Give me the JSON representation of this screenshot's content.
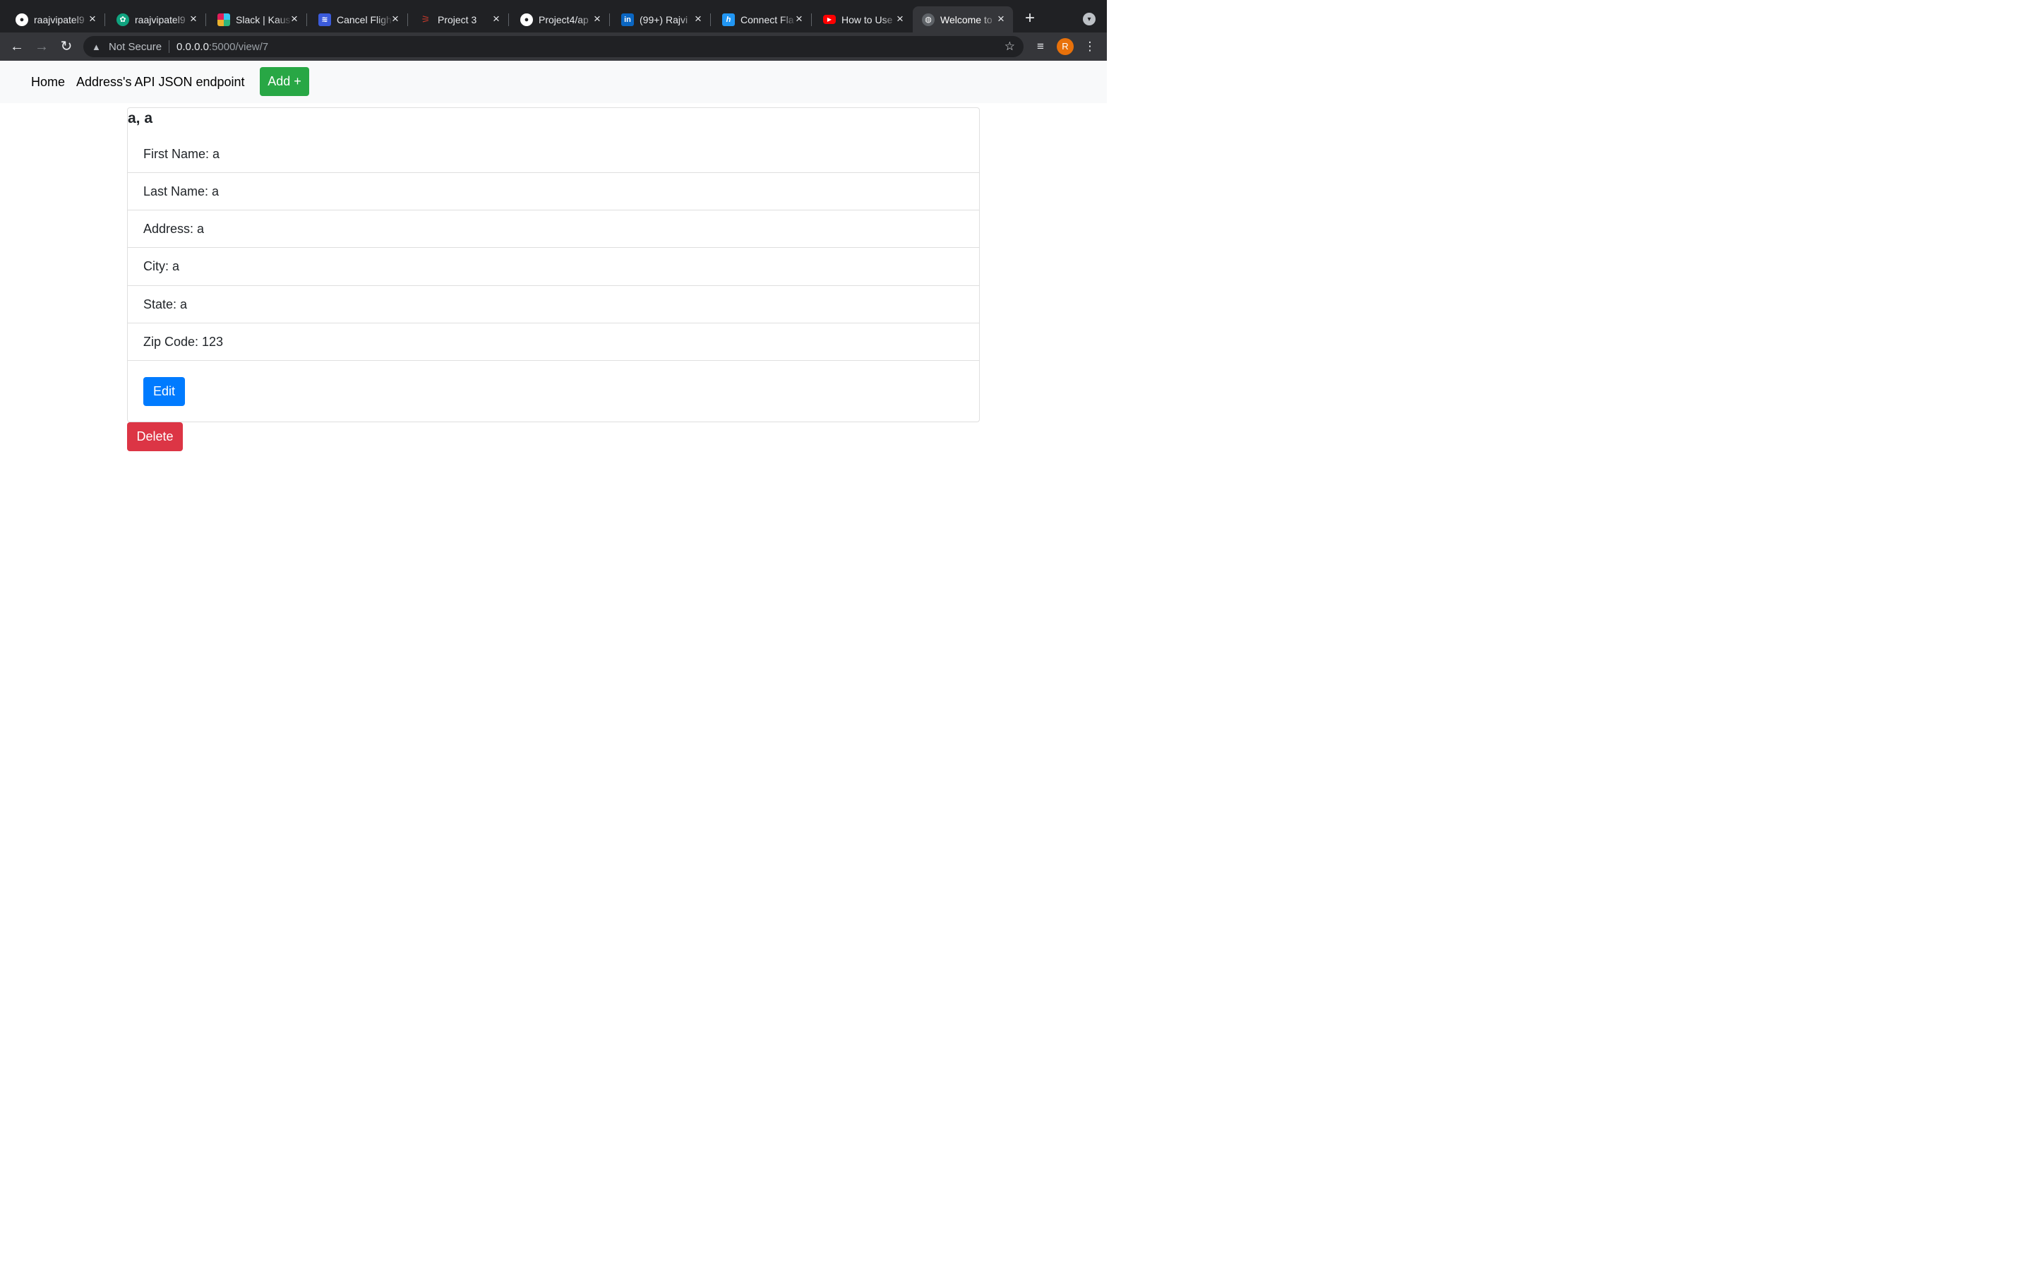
{
  "browser": {
    "tabs": [
      {
        "title": "raajvipatel9",
        "icon": "github-icon",
        "color": "#ffffff"
      },
      {
        "title": "raajvipatel9",
        "icon": "openai-icon",
        "color": "#10a37f"
      },
      {
        "title": "Slack | Kaus",
        "icon": "slack-icon",
        "color": "#e01e5a"
      },
      {
        "title": "Cancel Fligh",
        "icon": "airline-icon",
        "color": "#3b5bdb"
      },
      {
        "title": "Project 3",
        "icon": "project-icon",
        "color": "#c0392b"
      },
      {
        "title": "Project4/ap",
        "icon": "github-icon",
        "color": "#ffffff"
      },
      {
        "title": "(99+) Rajvi",
        "icon": "linkedin-icon",
        "color": "#0a66c2"
      },
      {
        "title": "Connect Fla",
        "icon": "heroku-icon",
        "color": "#2196f3"
      },
      {
        "title": "How to Use",
        "icon": "youtube-icon",
        "color": "#ff0000"
      },
      {
        "title": "Welcome to",
        "icon": "globe-icon",
        "color": "#5f6368"
      }
    ],
    "address": {
      "security_label": "Not Secure",
      "host": "0.0.0.0",
      "path": ":5000/view/7"
    },
    "profile_initial": "R"
  },
  "nav": {
    "home_label": "Home",
    "api_label": "Address's API JSON endpoint",
    "add_label": "Add +"
  },
  "card": {
    "title": "a, a",
    "fields": [
      "First Name: a",
      "Last Name: a",
      "Address: a",
      "City: a",
      "State: a",
      "Zip Code: 123"
    ],
    "edit_label": "Edit"
  },
  "delete_label": "Delete",
  "colors": {
    "add": "#28a745",
    "edit": "#007bff",
    "delete": "#dc3545"
  }
}
